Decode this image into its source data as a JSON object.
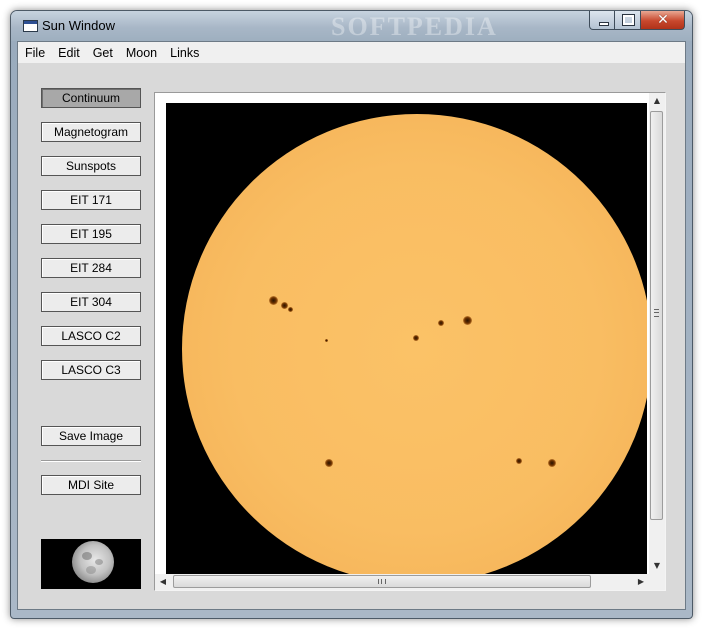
{
  "window": {
    "title": "Sun Window",
    "watermark": "SOFTPEDIA"
  },
  "menu": [
    "File",
    "Edit",
    "Get",
    "Moon",
    "Links"
  ],
  "sidebar": {
    "buttons": [
      {
        "label": "Continuum",
        "pressed": true
      },
      {
        "label": "Magnetogram"
      },
      {
        "label": "Sunspots"
      },
      {
        "label": "EIT 171"
      },
      {
        "label": "EIT 195"
      },
      {
        "label": "EIT 284"
      },
      {
        "label": "EIT 304"
      },
      {
        "label": "LASCO C2"
      },
      {
        "label": "LASCO C3"
      }
    ],
    "save_label": "Save Image",
    "mdi_label": "MDI Site"
  },
  "colors": {
    "sun": "#f9bd62",
    "background": "#000000"
  }
}
